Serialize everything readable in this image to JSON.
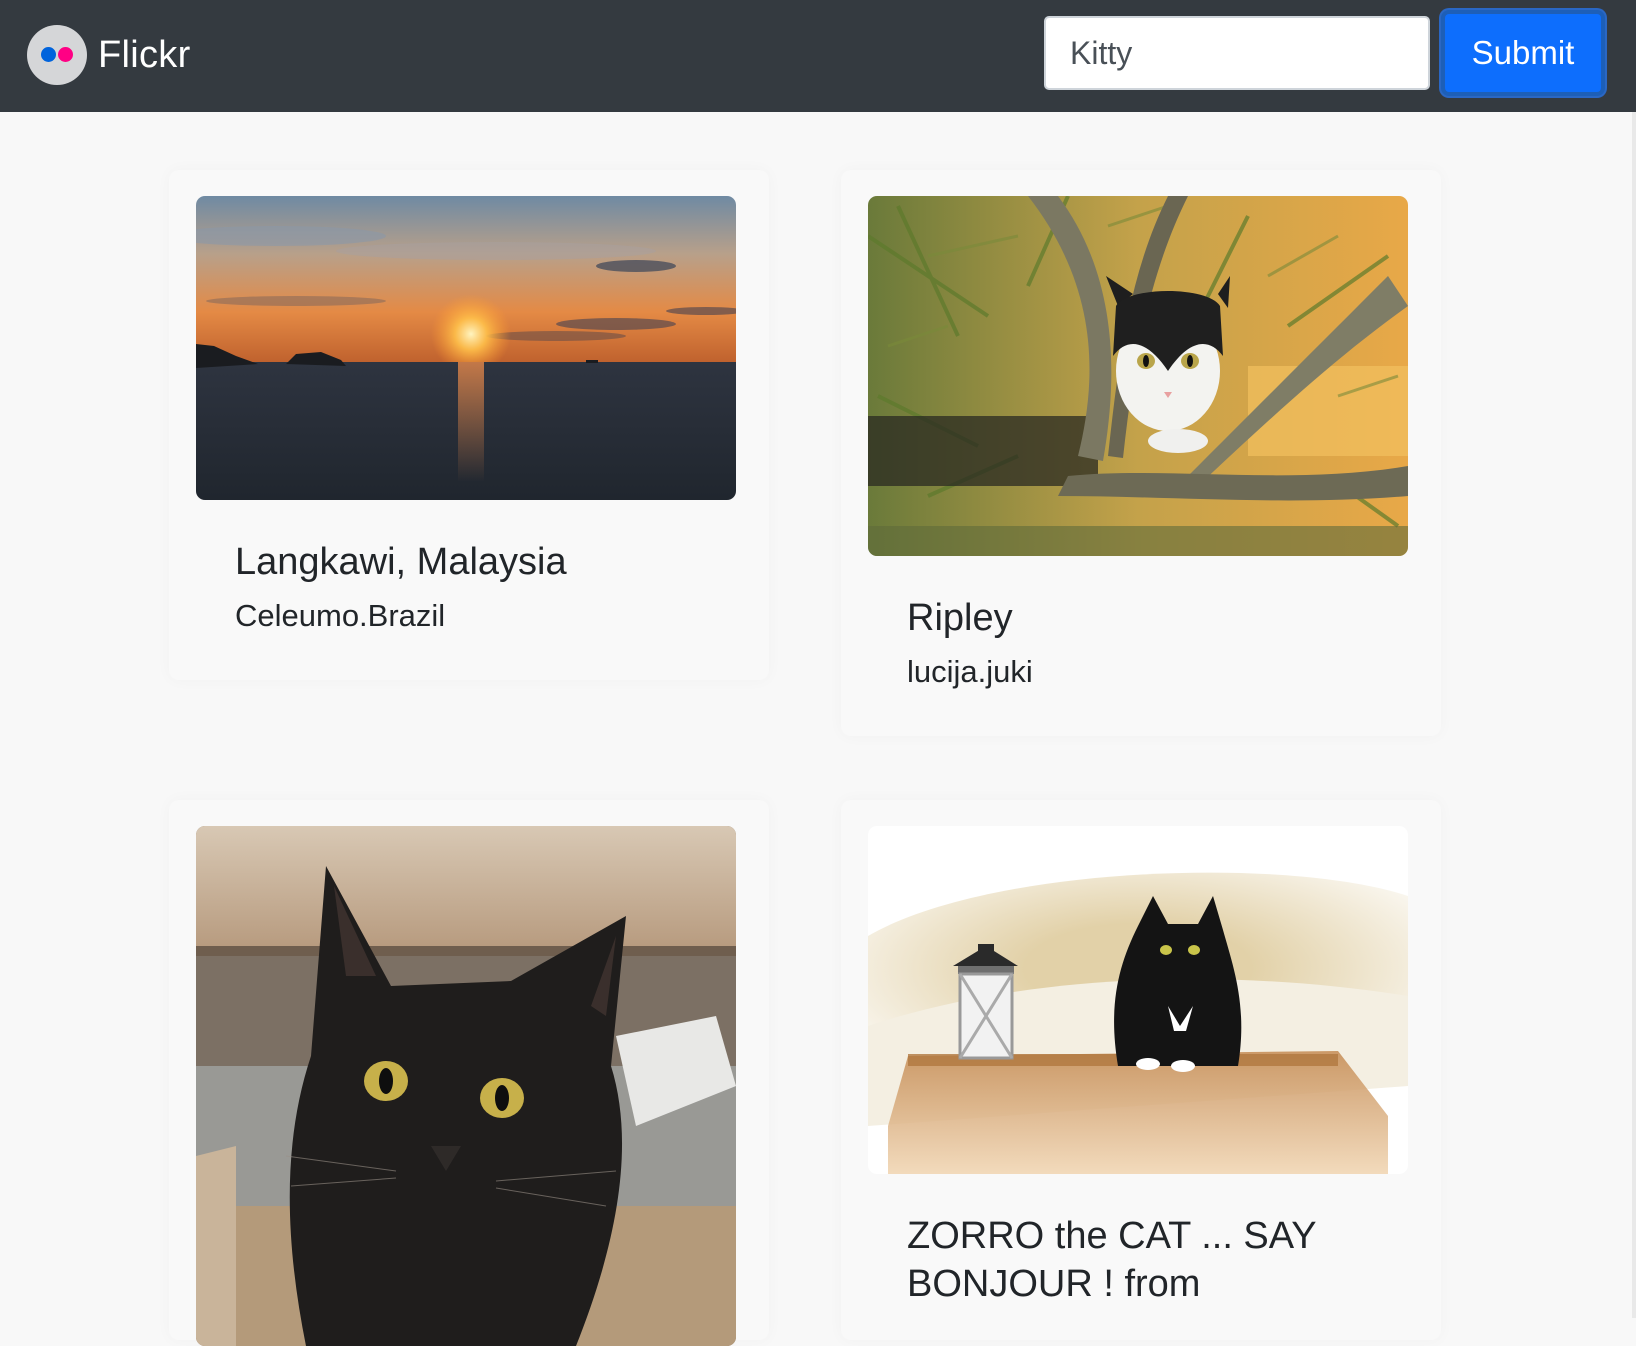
{
  "navbar": {
    "brand": "Flickr",
    "logo_colors": {
      "background": "#d5d6d8",
      "blue_dot": "#0063dc",
      "pink_dot": "#ff0084"
    },
    "search_value": "Kitty",
    "submit_label": "Submit"
  },
  "photos": [
    {
      "title": "Langkawi, Malaysia",
      "author": "Celeumo.Brazil",
      "subject": "sunset over the sea with islands"
    },
    {
      "title": "Ripley",
      "author": "lucija.juki",
      "subject": "black and white cat in a tree"
    },
    {
      "title": "",
      "author": "",
      "subject": "black kitten close-up"
    },
    {
      "title": "ZORRO the CAT ... SAY BONJOUR ! from",
      "author": "",
      "subject": "black cat with white chest on a wooden shelf next to a lantern"
    }
  ],
  "colors": {
    "navbar": "#343a40",
    "submit": "#0d6efd",
    "page_bg": "#f8f8f8"
  }
}
